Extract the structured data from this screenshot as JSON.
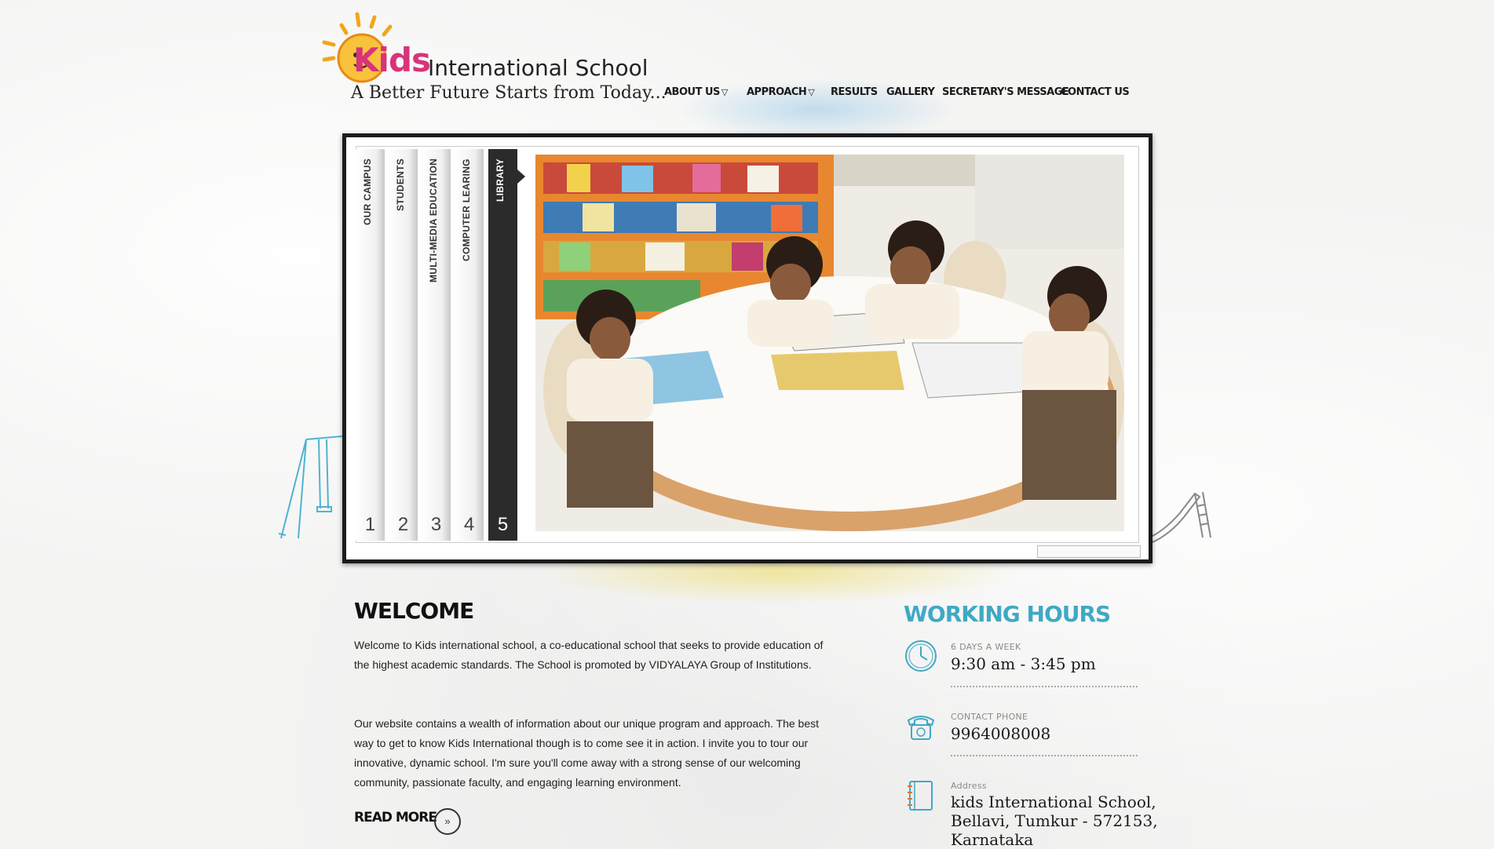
{
  "header": {
    "logo_kids": "Kids",
    "logo_title": "International School",
    "tagline": "A Better Future Starts from Today..."
  },
  "nav": {
    "items": [
      {
        "label": "ABOUT US",
        "has_dropdown": true
      },
      {
        "label": "APPROACH",
        "has_dropdown": true
      },
      {
        "label": "RESULTS",
        "has_dropdown": false
      },
      {
        "label": "GALLERY",
        "has_dropdown": false
      },
      {
        "label": "SECRETARY'S MESSAGE",
        "has_dropdown": false
      },
      {
        "label": "CONTACT US",
        "has_dropdown": false
      }
    ],
    "dropdown_glyph": "▽"
  },
  "slider": {
    "tabs": [
      {
        "label": "OUR CAMPUS",
        "number": "1"
      },
      {
        "label": "STUDENTS",
        "number": "2"
      },
      {
        "label": "MULTI-MEDIA EDUCATION",
        "number": "3"
      },
      {
        "label": "COMPUTER LEARING",
        "number": "4"
      },
      {
        "label": "LIBRARY",
        "number": "5"
      }
    ],
    "active_tab": 5
  },
  "welcome": {
    "heading": "WELCOME",
    "paragraph1": "Welcome to Kids international school, a co-educational school that seeks to provide education of the highest academic standards. The School is promoted by VIDYALAYA Group of Institutions.",
    "paragraph2": "Our website contains a wealth of information about our unique program and approach. The best way to get to know Kids International though is to come see it in action. I invite you to tour our innovative, dynamic school. I'm sure you'll come away with a strong sense of our welcoming community, passionate faculty, and engaging learning environment.",
    "read_more": "READ MORE",
    "read_more_icon": "»"
  },
  "working_hours": {
    "heading": "WORKING HOURS",
    "items": [
      {
        "icon": "clock-icon",
        "caption": "6 DAYS A WEEK",
        "value": "9:30 am - 3:45 pm"
      },
      {
        "icon": "phone-icon",
        "caption": "CONTACT PHONE",
        "value": "9964008008"
      },
      {
        "icon": "notebook-icon",
        "caption": "Address",
        "value_lines": [
          "kids International School,",
          "Bellavi, Tumkur - 572153,",
          "Karnataka"
        ]
      }
    ]
  },
  "colors": {
    "accent_teal": "#3fa9c5",
    "kids_pink": "#d9337a",
    "kids_blue": "#2d6fb8",
    "dark": "#1b1b1b"
  }
}
